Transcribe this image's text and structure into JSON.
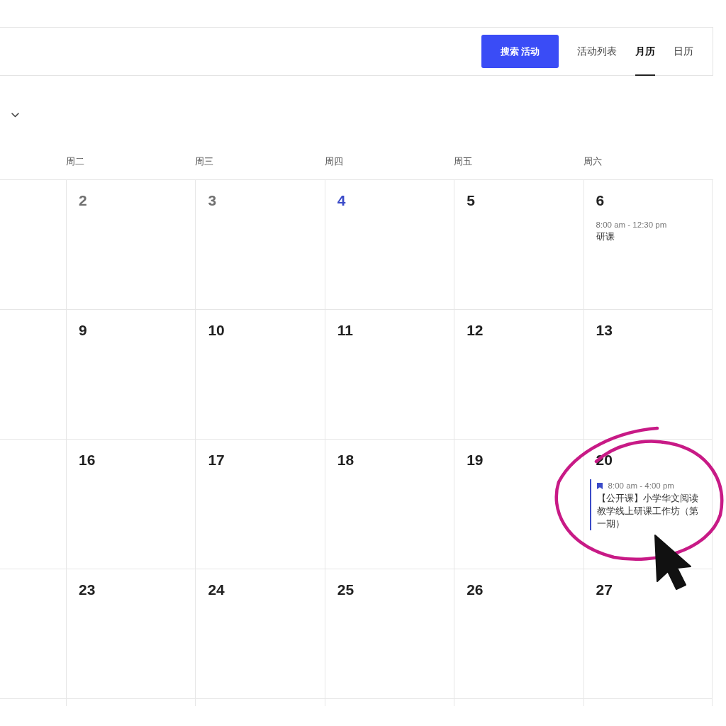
{
  "toolbar": {
    "search_button": "搜索 活动",
    "view_tabs": [
      {
        "label": "活动列表",
        "selected": false
      },
      {
        "label": "月历",
        "selected": true
      },
      {
        "label": "日历",
        "selected": false
      }
    ]
  },
  "calendar": {
    "weekdays": [
      "周二",
      "周三",
      "周四",
      "周五",
      "周六"
    ],
    "weeks": [
      {
        "days": [
          {
            "date": "2",
            "past": true,
            "today": false,
            "circled": false
          },
          {
            "date": "3",
            "past": true,
            "today": false,
            "circled": false
          },
          {
            "date": "4",
            "past": false,
            "today": true,
            "circled": false
          },
          {
            "date": "5",
            "past": false,
            "today": false,
            "circled": false
          },
          {
            "date": "6",
            "past": false,
            "today": false,
            "circled": false,
            "events": [
              {
                "kind": "plain",
                "time": "8:00 am - 12:30 pm",
                "title": "研课"
              }
            ]
          }
        ]
      },
      {
        "days": [
          {
            "date": "9",
            "past": false,
            "today": false,
            "circled": false
          },
          {
            "date": "10",
            "past": false,
            "today": false,
            "circled": false
          },
          {
            "date": "11",
            "past": false,
            "today": false,
            "circled": false
          },
          {
            "date": "12",
            "past": false,
            "today": false,
            "circled": false
          },
          {
            "date": "13",
            "past": false,
            "today": false,
            "circled": false
          }
        ]
      },
      {
        "days": [
          {
            "date": "16",
            "past": false,
            "today": false,
            "circled": false
          },
          {
            "date": "17",
            "past": false,
            "today": false,
            "circled": false
          },
          {
            "date": "18",
            "past": false,
            "today": false,
            "circled": false
          },
          {
            "date": "19",
            "past": false,
            "today": false,
            "circled": false
          },
          {
            "date": "20",
            "past": false,
            "today": false,
            "circled": true,
            "events": [
              {
                "kind": "flagged",
                "time": "8:00 am - 4:00 pm",
                "title": "【公开课】小学华文阅读教学线上研课工作坊（第一期）"
              }
            ]
          }
        ]
      },
      {
        "days": [
          {
            "date": "23",
            "past": false,
            "today": false,
            "circled": false
          },
          {
            "date": "24",
            "past": false,
            "today": false,
            "circled": false
          },
          {
            "date": "25",
            "past": false,
            "today": false,
            "circled": false
          },
          {
            "date": "26",
            "past": false,
            "today": false,
            "circled": false
          },
          {
            "date": "27",
            "past": false,
            "today": false,
            "circled": false
          }
        ]
      }
    ]
  }
}
